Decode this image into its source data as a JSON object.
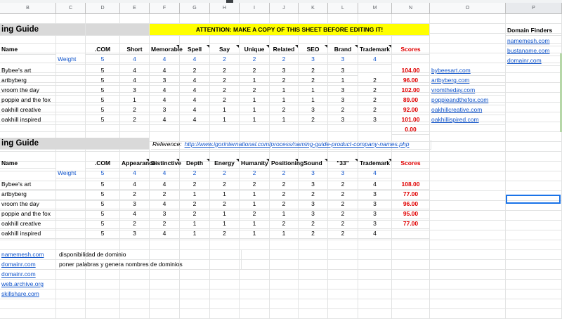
{
  "columns": [
    "B",
    "C",
    "D",
    "E",
    "F",
    "G",
    "H",
    "I",
    "J",
    "K",
    "L",
    "M",
    "N",
    "O",
    "P"
  ],
  "top": {
    "title": "ing Guide",
    "banner": "ATTENTION: MAKE A COPY OF THIS SHEET BEFORE EDITING IT!",
    "headers": [
      "Name",
      ".COM",
      "Short",
      "Memorable",
      "Spell",
      "Say",
      "Unique",
      "Related",
      "SEO",
      "Brand",
      "Trademark",
      "Scores"
    ],
    "weight_label": "Weight",
    "weights": [
      "5",
      "4",
      "4",
      "4",
      "2",
      "2",
      "2",
      "3",
      "3",
      "4"
    ],
    "rows": [
      {
        "name": "Bybee's art",
        "vals": [
          "5",
          "4",
          "4",
          "2",
          "2",
          "2",
          "3",
          "2",
          "3"
        ],
        "score": "104.00",
        "domain": "bybeesart.com"
      },
      {
        "name": "artbyberg",
        "vals": [
          "5",
          "4",
          "3",
          "4",
          "2",
          "1",
          "2",
          "2",
          "1",
          "2"
        ],
        "score": "96.00",
        "domain": "artbyberg.com"
      },
      {
        "name": "vroom the day",
        "vals": [
          "5",
          "3",
          "4",
          "4",
          "2",
          "2",
          "1",
          "1",
          "3",
          "2"
        ],
        "score": "102.00",
        "domain": "vromtheday.com"
      },
      {
        "name": "poppie and the fox",
        "vals": [
          "5",
          "1",
          "4",
          "4",
          "2",
          "1",
          "1",
          "1",
          "3",
          "2"
        ],
        "score": "89.00",
        "domain": "poppieandthefox.com"
      },
      {
        "name": "oakhill creative",
        "vals": [
          "5",
          "2",
          "3",
          "4",
          "1",
          "1",
          "2",
          "3",
          "2",
          "2"
        ],
        "score": "92.00",
        "domain": "oakhillcreative.com"
      },
      {
        "name": "oakhill inspired",
        "vals": [
          "5",
          "2",
          "4",
          "4",
          "1",
          "1",
          "1",
          "2",
          "3",
          "3"
        ],
        "score": "101.00",
        "domain": "oakhillispired.com"
      }
    ],
    "extra_score": "0.00"
  },
  "finders": {
    "title": "Domain Finders",
    "links": [
      "namemesh.com",
      "bustaname.com",
      "domainr.com"
    ]
  },
  "bottom": {
    "title": "ing Guide",
    "reference_label": "Reference:",
    "reference_url": "http://www.igorinternational.com/process/naming-guide-product-company-names.php",
    "headers": [
      "Name",
      ".COM",
      "Appearance",
      "Distinctive",
      "Depth",
      "Energy",
      "Humanity",
      "Positioning",
      "Sound",
      "\"33\"",
      "Trademark",
      "Scores"
    ],
    "weight_label": "Weight",
    "weights": [
      "5",
      "4",
      "4",
      "2",
      "2",
      "2",
      "2",
      "3",
      "3",
      "4"
    ],
    "rows": [
      {
        "name": "Bybee's art",
        "vals": [
          "5",
          "4",
          "4",
          "2",
          "2",
          "2",
          "2",
          "3",
          "2",
          "4"
        ],
        "score": "108.00"
      },
      {
        "name": "artbyberg",
        "vals": [
          "5",
          "2",
          "2",
          "1",
          "1",
          "1",
          "2",
          "2",
          "2",
          "3"
        ],
        "score": "77.00"
      },
      {
        "name": "vroom the day",
        "vals": [
          "5",
          "3",
          "4",
          "2",
          "2",
          "1",
          "2",
          "3",
          "2",
          "3"
        ],
        "score": "96.00"
      },
      {
        "name": "poppie and the fox",
        "vals": [
          "5",
          "4",
          "3",
          "2",
          "1",
          "2",
          "1",
          "3",
          "2",
          "3"
        ],
        "score": "95.00"
      },
      {
        "name": "oakhill creative",
        "vals": [
          "5",
          "2",
          "2",
          "1",
          "1",
          "1",
          "2",
          "2",
          "2",
          "3"
        ],
        "score": "77.00"
      },
      {
        "name": "oakhill inspired",
        "vals": [
          "5",
          "3",
          "4",
          "1",
          "2",
          "1",
          "1",
          "2",
          "2",
          "4"
        ],
        "score": ""
      }
    ]
  },
  "notes": [
    {
      "link": "namemesh.com",
      "text": "disponibilidad de dominio"
    },
    {
      "link": "domainr.com",
      "text": "poner palabras y genera nombres de dominios"
    },
    {
      "link": "domainr.com",
      "text": ""
    },
    {
      "link": "web.archive.org",
      "text": ""
    },
    {
      "link": "skillshare.com",
      "text": ""
    }
  ]
}
